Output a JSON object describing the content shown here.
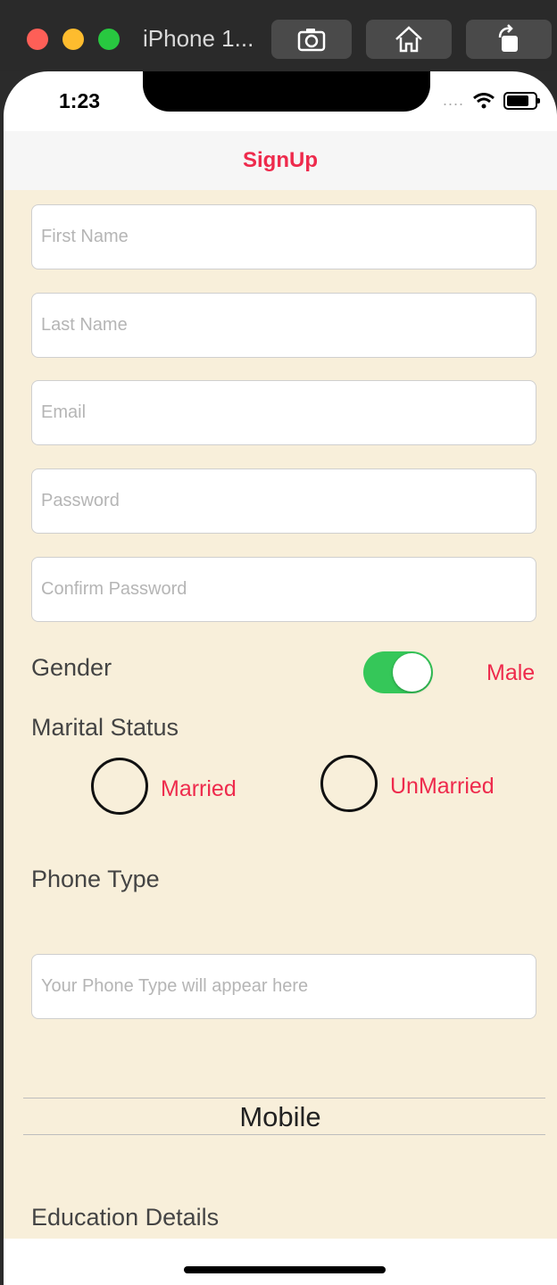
{
  "simulator": {
    "title": "iPhone 1...",
    "toolbar": {
      "screenshot_icon": "camera-icon",
      "home_icon": "home-icon",
      "rotate_icon": "rotate-icon"
    }
  },
  "status_bar": {
    "time": "1:23",
    "signal": "....",
    "wifi_icon": "wifi-icon",
    "battery_icon": "battery-icon"
  },
  "nav": {
    "title": "SignUp"
  },
  "form": {
    "first_name_placeholder": "First Name",
    "last_name_placeholder": "Last Name",
    "email_placeholder": "Email",
    "password_placeholder": "Password",
    "confirm_password_placeholder": "Confirm Password",
    "gender_label": "Gender",
    "gender_value": "Male",
    "gender_switch_on": true,
    "marital_label": "Marital Status",
    "married_label": "Married",
    "unmarried_label": "UnMarried",
    "phone_type_label": "Phone Type",
    "phone_type_placeholder": "Your Phone Type will appear here",
    "picker_selected": "Mobile",
    "education_label": "Education Details"
  },
  "colors": {
    "accent": "#ee2a4c",
    "background": "#f8efda",
    "switch_on": "#35c759"
  }
}
